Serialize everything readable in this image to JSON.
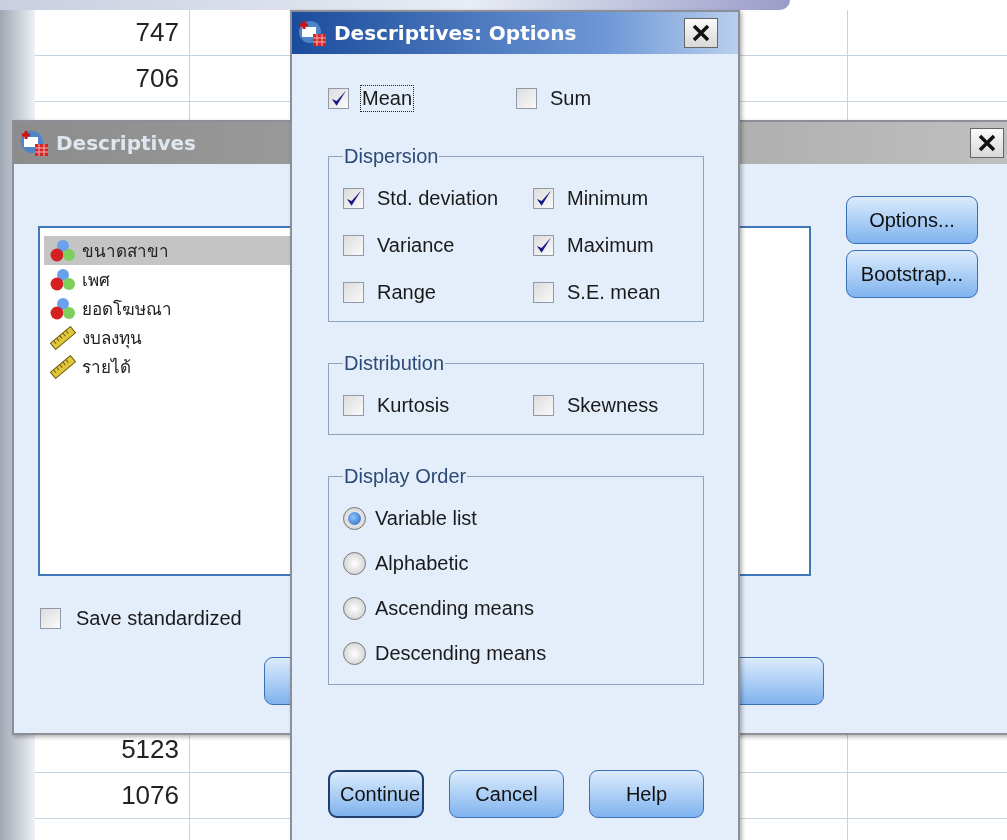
{
  "spreadsheet": {
    "top_rows": [
      "747",
      "706"
    ],
    "bottom_rows": [
      "5123",
      "1076"
    ]
  },
  "descriptives": {
    "title": "Descriptives",
    "variables": [
      {
        "name": "ขนาดสาขา",
        "kind": "nominal",
        "selected": true
      },
      {
        "name": "เพศ",
        "kind": "nominal",
        "selected": false
      },
      {
        "name": "ยอดโฆษณา",
        "kind": "nominal",
        "selected": false
      },
      {
        "name": "งบลงทุน",
        "kind": "scale",
        "selected": false
      },
      {
        "name": "รายได้",
        "kind": "scale",
        "selected": false
      }
    ],
    "side_buttons": [
      "Options...",
      "Bootstrap..."
    ],
    "save_option": {
      "label": "Save standardized",
      "checked": false
    }
  },
  "options": {
    "title": "Descriptives: Options",
    "top": [
      {
        "label": "Mean",
        "checked": true,
        "focused": true
      },
      {
        "label": "Sum",
        "checked": false,
        "focused": false
      }
    ],
    "groups": [
      {
        "title": "Dispersion",
        "kind": "checkboxes",
        "items": [
          {
            "label": "Std. deviation",
            "checked": true
          },
          {
            "label": "Minimum",
            "checked": true
          },
          {
            "label": "Variance",
            "checked": false
          },
          {
            "label": "Maximum",
            "checked": true
          },
          {
            "label": "Range",
            "checked": false
          },
          {
            "label": "S.E. mean",
            "checked": false
          }
        ]
      },
      {
        "title": "Distribution",
        "kind": "checkboxes",
        "items": [
          {
            "label": "Kurtosis",
            "checked": false
          },
          {
            "label": "Skewness",
            "checked": false
          }
        ]
      },
      {
        "title": "Display Order",
        "kind": "radios",
        "items": [
          {
            "label": "Variable list",
            "selected": true
          },
          {
            "label": "Alphabetic",
            "selected": false
          },
          {
            "label": "Ascending means",
            "selected": false
          },
          {
            "label": "Descending means",
            "selected": false
          }
        ]
      }
    ],
    "buttons": [
      {
        "label": "Continue",
        "default": true
      },
      {
        "label": "Cancel",
        "default": false
      },
      {
        "label": "Help",
        "default": false
      }
    ]
  }
}
